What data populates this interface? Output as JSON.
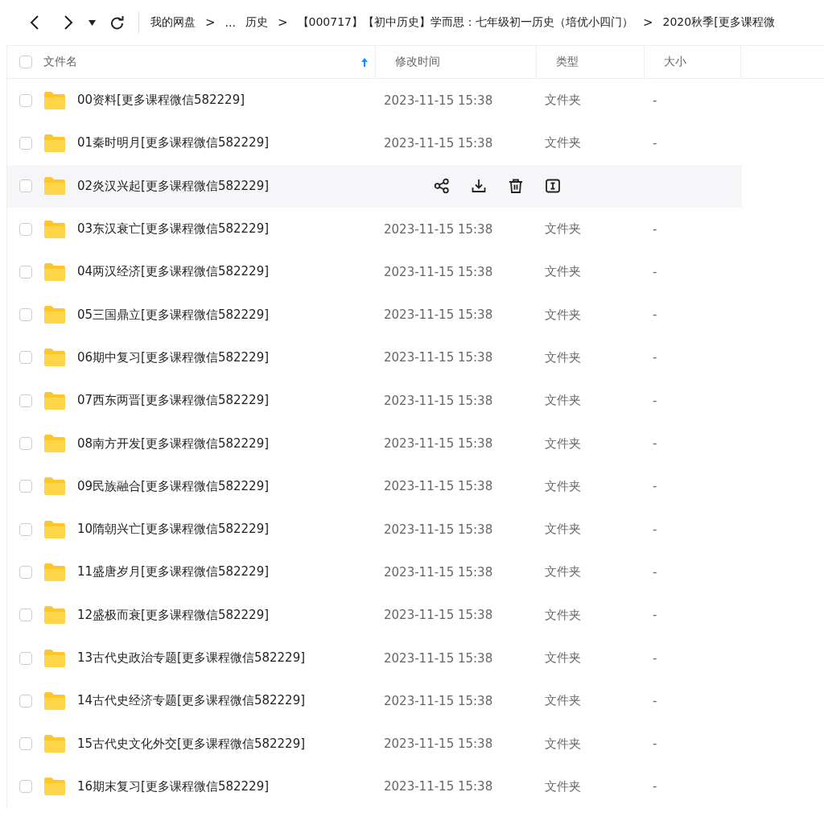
{
  "toolbar": {
    "breadcrumb": [
      {
        "label": "我的网盘",
        "kind": "link"
      },
      {
        "label": ">",
        "kind": "separator"
      },
      {
        "label": "...",
        "kind": "link"
      },
      {
        "label": "历史",
        "kind": "link"
      },
      {
        "label": ">",
        "kind": "separator"
      },
      {
        "label": "【000717】【初中历史】学而思：七年级初一历史（培优小四门）",
        "kind": "link"
      },
      {
        "label": ">",
        "kind": "separator"
      },
      {
        "label": "2020秋季[更多课程微",
        "kind": "link"
      }
    ]
  },
  "table": {
    "select_all": {
      "checked": false
    },
    "columns": [
      {
        "label": "文件名",
        "sorted": true
      },
      {
        "label": "修改时间",
        "sorted": false
      },
      {
        "label": "类型",
        "sorted": false
      },
      {
        "label": "大小",
        "sorted": false
      }
    ],
    "rows": [
      {
        "name": "00资料[更多课程微信582229]",
        "modified": "2023-11-15 15:38",
        "type": "文件夹",
        "size": "-",
        "checked": false,
        "hovered": false
      },
      {
        "name": "01秦时明月[更多课程微信582229]",
        "modified": "2023-11-15 15:38",
        "type": "文件夹",
        "size": "-",
        "checked": false,
        "hovered": false
      },
      {
        "name": "02炎汉兴起[更多课程微信582229]",
        "checked": false,
        "hovered": true
      },
      {
        "name": "03东汉衰亡[更多课程微信582229]",
        "modified": "2023-11-15 15:38",
        "type": "文件夹",
        "size": "-",
        "checked": false,
        "hovered": false
      },
      {
        "name": "04两汉经济[更多课程微信582229]",
        "modified": "2023-11-15 15:38",
        "type": "文件夹",
        "size": "-",
        "checked": false,
        "hovered": false
      },
      {
        "name": "05三国鼎立[更多课程微信582229]",
        "modified": "2023-11-15 15:38",
        "type": "文件夹",
        "size": "-",
        "checked": false,
        "hovered": false
      },
      {
        "name": "06期中复习[更多课程微信582229]",
        "modified": "2023-11-15 15:38",
        "type": "文件夹",
        "size": "-",
        "checked": false,
        "hovered": false
      },
      {
        "name": "07西东两晋[更多课程微信582229]",
        "modified": "2023-11-15 15:38",
        "type": "文件夹",
        "size": "-",
        "checked": false,
        "hovered": false
      },
      {
        "name": "08南方开发[更多课程微信582229]",
        "modified": "2023-11-15 15:38",
        "type": "文件夹",
        "size": "-",
        "checked": false,
        "hovered": false
      },
      {
        "name": "09民族融合[更多课程微信582229]",
        "modified": "2023-11-15 15:38",
        "type": "文件夹",
        "size": "-",
        "checked": false,
        "hovered": false
      },
      {
        "name": "10隋朝兴亡[更多课程微信582229]",
        "modified": "2023-11-15 15:38",
        "type": "文件夹",
        "size": "-",
        "checked": false,
        "hovered": false
      },
      {
        "name": "11盛唐岁月[更多课程微信582229]",
        "modified": "2023-11-15 15:38",
        "type": "文件夹",
        "size": "-",
        "checked": false,
        "hovered": false
      },
      {
        "name": "12盛极而衰[更多课程微信582229]",
        "modified": "2023-11-15 15:38",
        "type": "文件夹",
        "size": "-",
        "checked": false,
        "hovered": false
      },
      {
        "name": "13古代史政治专题[更多课程微信582229]",
        "modified": "2023-11-15 15:38",
        "type": "文件夹",
        "size": "-",
        "checked": false,
        "hovered": false
      },
      {
        "name": "14古代史经济专题[更多课程微信582229]",
        "modified": "2023-11-15 15:38",
        "type": "文件夹",
        "size": "-",
        "checked": false,
        "hovered": false
      },
      {
        "name": "15古代史文化外交[更多课程微信582229]",
        "modified": "2023-11-15 15:38",
        "type": "文件夹",
        "size": "-",
        "checked": false,
        "hovered": false
      },
      {
        "name": "16期末复习[更多课程微信582229]",
        "modified": "2023-11-15 15:38",
        "type": "文件夹",
        "size": "-",
        "checked": false,
        "hovered": false
      }
    ]
  }
}
